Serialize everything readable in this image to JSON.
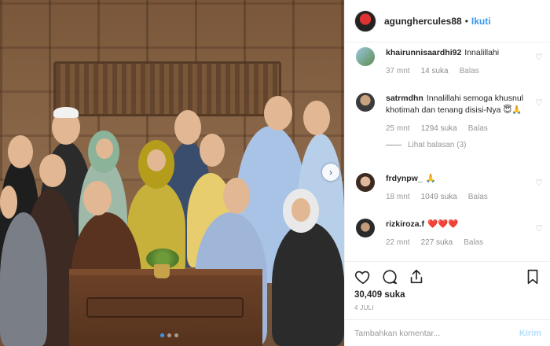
{
  "header": {
    "username": "agunghercules88",
    "separator": "•",
    "follow_label": "Ikuti"
  },
  "comments": [
    {
      "username": "khairunnisaardhi92",
      "text": "Innalillahi",
      "time": "37 mnt",
      "likes": "14 suka",
      "reply_label": "Balas"
    },
    {
      "username": "satrmdhn",
      "text": "Innalillahi semoga khusnul khotimah dan tenang disisi-Nya 😇🙏",
      "time": "25 mnt",
      "likes": "1294 suka",
      "reply_label": "Balas",
      "view_replies": "Lihat balasan (3)"
    },
    {
      "username": "frdynpw_",
      "text": "🙏",
      "time": "18 mnt",
      "likes": "1049 suka",
      "reply_label": "Balas"
    },
    {
      "username": "rizkiroza.f",
      "text": "❤️❤️❤️",
      "time": "22 mnt",
      "likes": "227 suka",
      "reply_label": "Balas"
    }
  ],
  "actions": {
    "like_count": "30,409 suka",
    "date": "4 JULI"
  },
  "add_comment": {
    "placeholder": "Tambahkan komentar...",
    "post_label": "Kirim"
  },
  "colors": {
    "accent": "#3897f0",
    "post_disabled": "#b2dffc",
    "heart_red": "#ed4956"
  }
}
